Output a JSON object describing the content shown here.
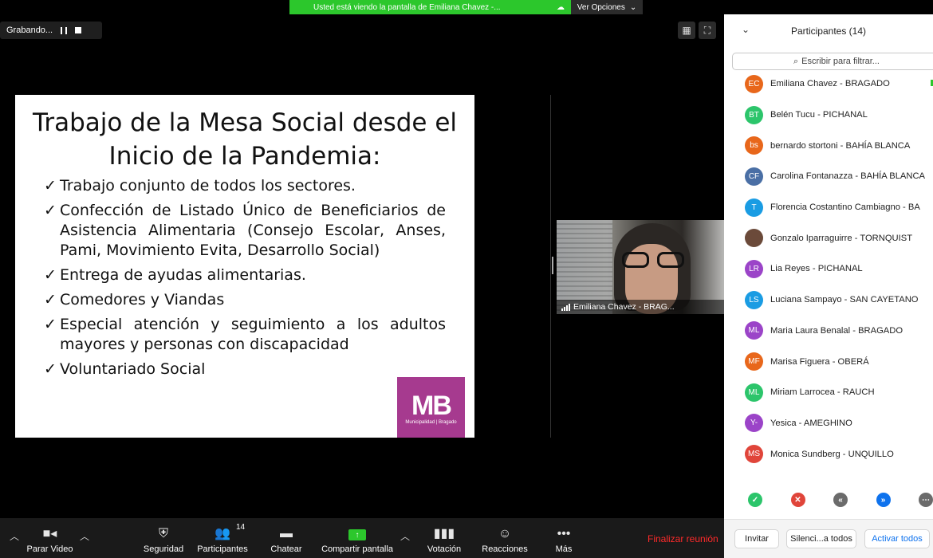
{
  "banner": {
    "text": "Usted está viendo la pantalla de Emiliana Chavez -...",
    "view_options": "Ver Opciones"
  },
  "recording": {
    "label": "Grabando..."
  },
  "slide": {
    "title": "Trabajo de la Mesa Social desde el Inicio de la Pandemia:",
    "items": [
      "Trabajo conjunto de todos los sectores.",
      "Confección de Listado Único de Beneficiarios de Asistencia Alimentaria (Consejo Escolar, Anses, Pami, Movimiento Evita, Desarrollo Social)",
      "Entrega de ayudas alimentarias.",
      "Comedores y Viandas",
      "Especial atención y seguimiento a los adultos mayores y personas con discapacidad",
      "Voluntariado Social"
    ],
    "logo_main": "MB",
    "logo_sub": "Municipalidad | Bragado"
  },
  "video": {
    "name": "Emiliana Chavez - BRAG..."
  },
  "toolbar": {
    "stop_video": "Parar Video",
    "security": "Seguridad",
    "participants": "Participantes",
    "participant_count": "14",
    "chat": "Chatear",
    "share": "Compartir pantalla",
    "polling": "Votación",
    "reactions": "Reacciones",
    "more": "Más",
    "end": "Finalizar reunión"
  },
  "panel": {
    "title": "Participantes (14)",
    "search_placeholder": "Escribir para filtrar...",
    "participants": [
      {
        "initials": "EC",
        "name": "Emiliana Chavez - BRAGADO",
        "color": "#e8671b"
      },
      {
        "initials": "BT",
        "name": "Belén Tucu - PICHANAL",
        "color": "#2cc56b"
      },
      {
        "initials": "bs",
        "name": "bernardo stortoni - BAHÍA BLANCA",
        "color": "#e8671b"
      },
      {
        "initials": "CF",
        "name": "Carolina Fontanazza - BAHÍA BLANCA",
        "color": "#4a6fa5"
      },
      {
        "initials": "T",
        "name": "Florencia Costantino Cambiagno - BA",
        "color": "#1a9ce3"
      },
      {
        "initials": "",
        "name": "Gonzalo Iparraguirre - TORNQUIST",
        "color": "#6b4a3a"
      },
      {
        "initials": "LR",
        "name": "Lia Reyes - PICHANAL",
        "color": "#9b44c8"
      },
      {
        "initials": "LS",
        "name": "Luciana Sampayo - SAN CAYETANO",
        "color": "#1a9ce3"
      },
      {
        "initials": "ML",
        "name": "Maria Laura Benalal - BRAGADO",
        "color": "#9b44c8"
      },
      {
        "initials": "MF",
        "name": "Marisa Figuera - OBERÁ",
        "color": "#e8671b"
      },
      {
        "initials": "ML",
        "name": "Miriam Larrocea - RAUCH",
        "color": "#2cc56b"
      },
      {
        "initials": "Y-",
        "name": "Yesica - AMEGHINO",
        "color": "#9b44c8"
      },
      {
        "initials": "MS",
        "name": "Monica Sundberg - UNQUILLO",
        "color": "#e0453a"
      }
    ],
    "invite": "Invitar",
    "mute_all": "Silenci...a todos",
    "unmute_all": "Activar todos"
  }
}
